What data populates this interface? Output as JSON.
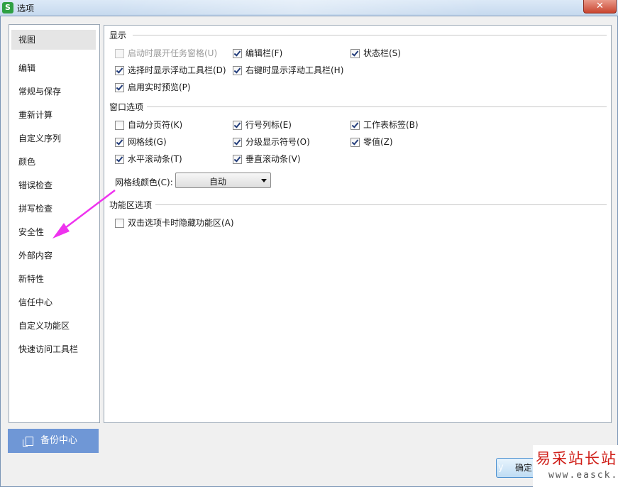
{
  "window": {
    "title": "选项",
    "app_icon_letter": "S",
    "close_symbol": "✕"
  },
  "sidebar": {
    "items": [
      {
        "label": "视图",
        "active": true
      },
      {
        "label": "编辑"
      },
      {
        "label": "常规与保存"
      },
      {
        "label": "重新计算"
      },
      {
        "label": "自定义序列"
      },
      {
        "label": "颜色"
      },
      {
        "label": "错误检查"
      },
      {
        "label": "拼写检查"
      },
      {
        "label": "安全性"
      },
      {
        "label": "外部内容"
      },
      {
        "label": "新特性"
      },
      {
        "label": "信任中心"
      },
      {
        "label": "自定义功能区"
      },
      {
        "label": "快速访问工具栏"
      }
    ],
    "backup_label": "备份中心"
  },
  "display": {
    "title": "显示",
    "options": [
      {
        "label": "启动时展开任务窗格(U)",
        "checked": false,
        "disabled": true
      },
      {
        "label": "编辑栏(F)",
        "checked": true
      },
      {
        "label": "状态栏(S)",
        "checked": true
      },
      {
        "label": "选择时显示浮动工具栏(D)",
        "checked": true
      },
      {
        "label": "右键时显示浮动工具栏(H)",
        "checked": true
      },
      {
        "label": "启用实时预览(P)",
        "checked": true
      }
    ]
  },
  "window_options": {
    "title": "窗口选项",
    "options": [
      {
        "label": "自动分页符(K)",
        "checked": false
      },
      {
        "label": "行号列标(E)",
        "checked": true
      },
      {
        "label": "工作表标签(B)",
        "checked": true
      },
      {
        "label": "网格线(G)",
        "checked": true
      },
      {
        "label": "分级显示符号(O)",
        "checked": true
      },
      {
        "label": "零值(Z)",
        "checked": true
      },
      {
        "label": "水平滚动条(T)",
        "checked": true
      },
      {
        "label": "垂直滚动条(V)",
        "checked": true
      }
    ],
    "gridline_color_label": "网格线颜色(C):",
    "gridline_color_value": "自动"
  },
  "ribbon_options": {
    "title": "功能区选项",
    "options": [
      {
        "label": "双击选项卡时隐藏功能区(A)",
        "checked": false
      }
    ]
  },
  "footer": {
    "ok_label": "确定",
    "ok_ghost": "y"
  },
  "watermark": {
    "main": "易采站长站",
    "sub": "www.easck.com"
  },
  "colors": {
    "accent": "#6f97d6",
    "arrow": "#ee33ee",
    "watermark_red": "#d0201a"
  }
}
